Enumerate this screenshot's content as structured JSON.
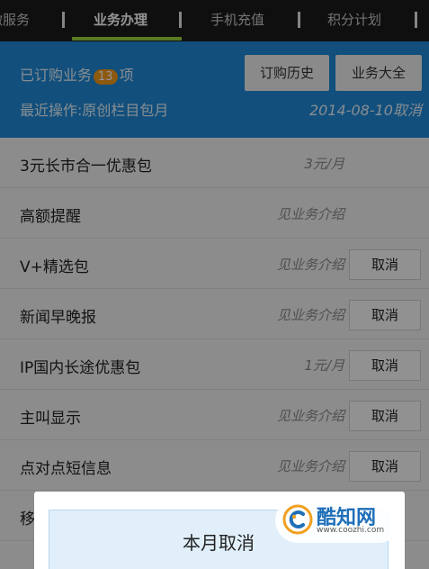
{
  "topnav": {
    "tabs": [
      {
        "label": "微服务"
      },
      {
        "label": "业务办理"
      },
      {
        "label": "手机充值"
      },
      {
        "label": "积分计划"
      }
    ],
    "separator": "|"
  },
  "info": {
    "subscribed_prefix": "已订购业务",
    "subscribed_count": "13",
    "subscribed_suffix": "项",
    "recent_label": "最近操作:原创栏目包月",
    "recent_date": "2014-08-10取消",
    "history_button": "订购历史",
    "all_button": "业务大全"
  },
  "services": [
    {
      "name": "3元长市合一优惠包",
      "price": "3元/月",
      "cancel": ""
    },
    {
      "name": "高额提醒",
      "price": "见业务介绍",
      "cancel": ""
    },
    {
      "name": "V+精选包",
      "price": "见业务介绍",
      "cancel": "取消"
    },
    {
      "name": "新闻早晚报",
      "price": "见业务介绍",
      "cancel": "取消"
    },
    {
      "name": "IP国内长途优惠包",
      "price": "1元/月",
      "cancel": "取消"
    },
    {
      "name": "主叫显示",
      "price": "见业务介绍",
      "cancel": "取消"
    },
    {
      "name": "点对点短信息",
      "price": "见业务介绍",
      "cancel": "取消"
    },
    {
      "name": "移",
      "price": "",
      "cancel": ""
    }
  ],
  "dialog": {
    "option_label": "本月取消"
  },
  "watermark": {
    "brand": "酷知网",
    "url": "www.coozhi.com"
  },
  "colors": {
    "header_blue": "#1f88d6",
    "badge_orange": "#f39a1b",
    "active_tab_underline": "#9bd23c",
    "nav_dark": "#1b1b1b"
  }
}
